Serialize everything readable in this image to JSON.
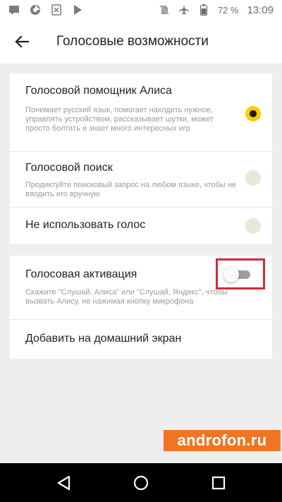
{
  "status_bar": {
    "battery": "72 %",
    "time": "13:09",
    "left_icons": [
      "message-icon",
      "chrome-like-icon",
      "crossed-file-icon",
      "play-store-icon"
    ],
    "right_icons": [
      "no-sim-icon",
      "airplane-mode-icon",
      "battery-icon"
    ]
  },
  "app_bar": {
    "title": "Голосовые возможности",
    "back_icon": "arrow-left-icon"
  },
  "voice_options": [
    {
      "title": "Голосовой помощник Алиса",
      "description": "Понимает русский язык, помогает находить нужное, управлять устройством, рассказывает шутки, может просто болтать и знает много интересных игр",
      "selected": true
    },
    {
      "title": "Голосовой поиск",
      "description": "Продиктуйте поисковый запрос на любом языке, чтобы не вводить его вручную",
      "selected": false
    },
    {
      "title": "Не использовать голос",
      "description": "",
      "selected": false
    }
  ],
  "activation": {
    "title": "Голосовая активация",
    "description": "Скажите \"Слушай, Алиса\" или \"Слушай, Яндекс\", чтобы вызвать Алису, не нажимая кнопку микрофона",
    "enabled": false
  },
  "home_screen": {
    "title": "Добавить на домашний экран"
  },
  "watermark": "androfon.ru",
  "colors": {
    "accent": "#ffcc00",
    "highlight_border": "#d62a35",
    "watermark_bg": "#f07522"
  }
}
